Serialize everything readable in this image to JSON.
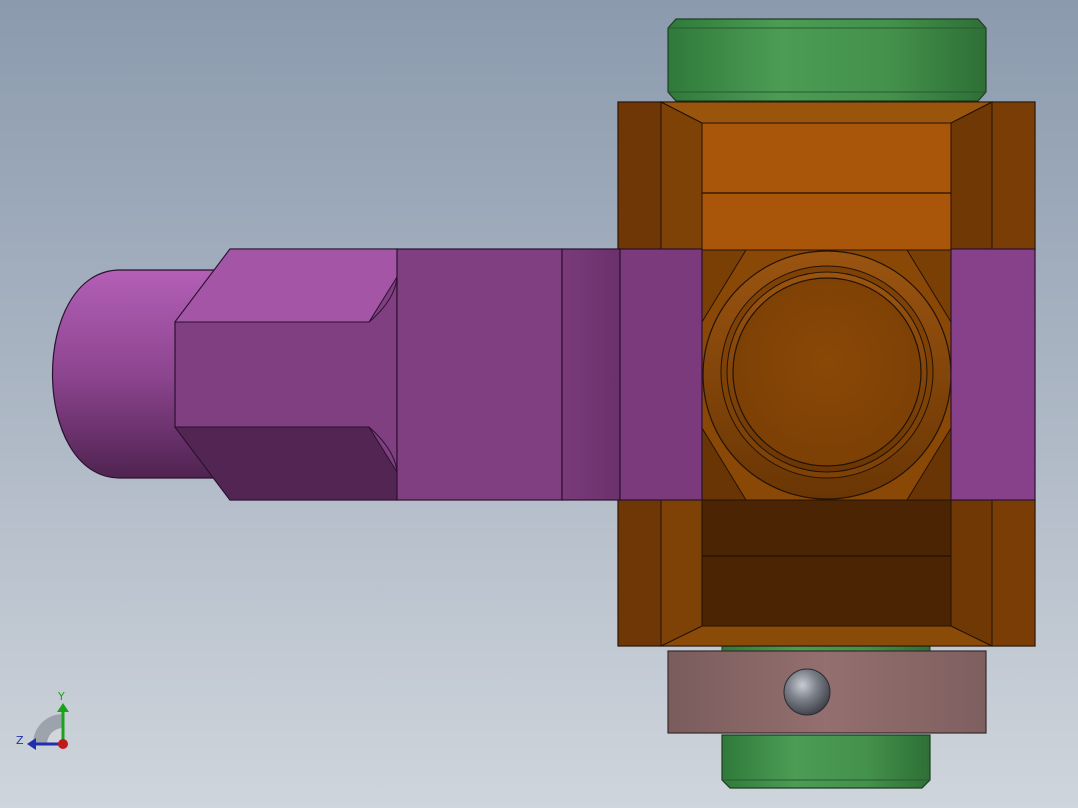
{
  "viewport": {
    "background_top": "#8b9aae",
    "background_bottom": "#cfd5dc"
  },
  "model": {
    "parts": [
      {
        "name": "handle-shaft",
        "color": "#8a3f86"
      },
      {
        "name": "valve-body",
        "color": "#8a4806"
      },
      {
        "name": "top-nut",
        "color": "#3f8f48"
      },
      {
        "name": "bottom-nut",
        "color": "#3f8f48"
      },
      {
        "name": "collar",
        "color": "#8a6a6a"
      },
      {
        "name": "set-ball",
        "color": "#6f727a"
      }
    ]
  },
  "triad": {
    "y_label": "Y",
    "z_label": "Z",
    "y_color": "#1aa31a",
    "z_color": "#1f2fb0",
    "x_color": "#c21a1a"
  }
}
